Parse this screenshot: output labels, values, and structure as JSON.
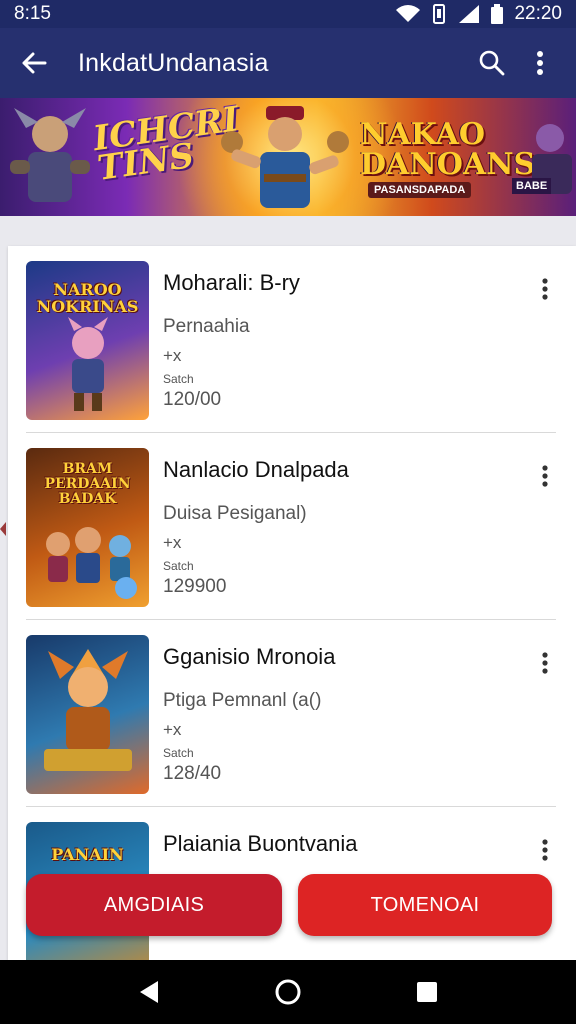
{
  "status_bar": {
    "time": "8:15",
    "clock": "22:20"
  },
  "app_bar": {
    "title": "InkdatUndanasia"
  },
  "banner": {
    "logo_left": "ICHCRI\nTINS",
    "logo_right": "NAKAO\nDANOANS",
    "tagline": "PASANSDAPADA",
    "badge": "BABE"
  },
  "items": [
    {
      "name": "Moharali: B-ry",
      "subtitle": "Pernaahia",
      "mark": "+x",
      "tiny": "Satch",
      "count": "120/00",
      "thumb_title": "NAROO\nNOKRINAS",
      "thumb_colors": [
        "#1c3a86",
        "#6e3fb0",
        "#ffa23a"
      ]
    },
    {
      "name": "Nanlacio Dnalpada",
      "subtitle": "Duisa Pesiganal)",
      "mark": "+x",
      "tiny": "Satch",
      "count": "129900",
      "thumb_title": "BRAM\nPERDAAIN\nBADAK",
      "thumb_colors": [
        "#5a2a10",
        "#c05a14",
        "#f0a030"
      ]
    },
    {
      "name": "Gganisio Mronoia",
      "subtitle": "Ptiga Pemnanl (a()",
      "mark": "+x",
      "tiny": "Satch",
      "count": "128/40",
      "thumb_title": "",
      "thumb_colors": [
        "#183a6a",
        "#2f7ab0",
        "#e06a2a"
      ]
    },
    {
      "name": "Plaiania Buontvania",
      "subtitle": "",
      "mark": "",
      "tiny": "",
      "count": "",
      "thumb_title": "PANAIN",
      "thumb_colors": [
        "#1a5a8a",
        "#2a8ac0",
        "#d08a2a"
      ]
    }
  ],
  "buttons": {
    "left_label": "AMGDIAIS",
    "right_label": "TOMENOAI"
  },
  "colors": {
    "status_bar": "#1f2a66",
    "app_bar": "#26306f",
    "primary_red": "#dd2424"
  },
  "icons": [
    "back-arrow-icon",
    "search-icon",
    "more-vert-icon",
    "wifi-icon",
    "signal-icon",
    "battery-icon",
    "nav-back-icon",
    "nav-home-icon",
    "nav-recents-icon"
  ]
}
